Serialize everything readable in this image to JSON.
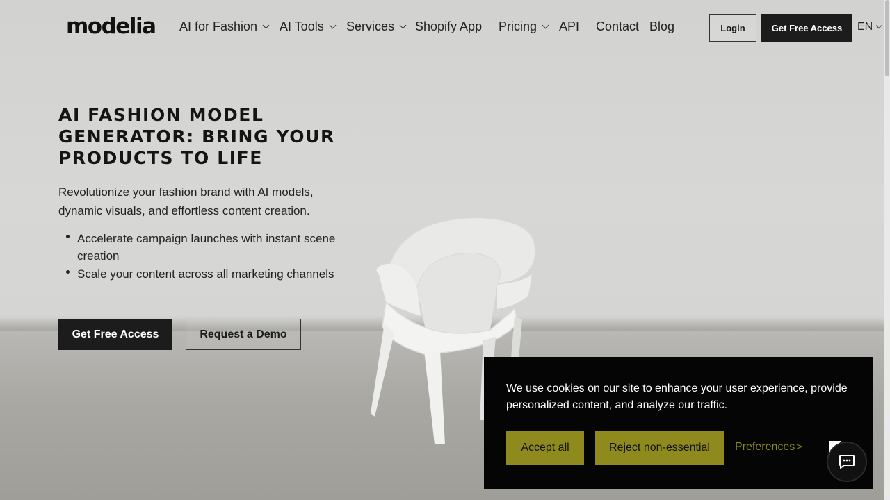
{
  "header": {
    "logo": "modelia",
    "nav": [
      {
        "label": "AI for Fashion",
        "dropdown": true
      },
      {
        "label": "AI Tools",
        "dropdown": true
      },
      {
        "label": "Services",
        "dropdown": true
      },
      {
        "label": "Shopify App",
        "dropdown": false
      },
      {
        "label": "Pricing",
        "dropdown": true
      },
      {
        "label": "API",
        "dropdown": false
      },
      {
        "label": "Contact",
        "dropdown": false
      },
      {
        "label": "Blog",
        "dropdown": false
      }
    ],
    "login_label": "Login",
    "cta_label": "Get Free Access",
    "language": "EN"
  },
  "hero": {
    "title": "AI Fashion Model Generator: Bring Your Products to Life",
    "subtitle": "Revolutionize your fashion brand with AI models, dynamic visuals, and effortless content creation.",
    "bullets": [
      "Accelerate campaign launches with instant scene creation",
      "Scale your content across all marketing channels"
    ],
    "primary_cta": "Get Free Access",
    "secondary_cta": "Request a Demo"
  },
  "cookie_banner": {
    "message": "We use cookies on our site to enhance your user experience, provide personalized content, and analyze our traffic.",
    "accept_label": "Accept all",
    "reject_label": "Reject non-essential",
    "preferences_label": "Preferences",
    "preferences_arrow": ">",
    "accent_color": "#8e8a1d"
  },
  "icons": {
    "chat": "chat-bubble-icon",
    "flag": "flag-icon",
    "chevron": "chevron-down-icon"
  }
}
